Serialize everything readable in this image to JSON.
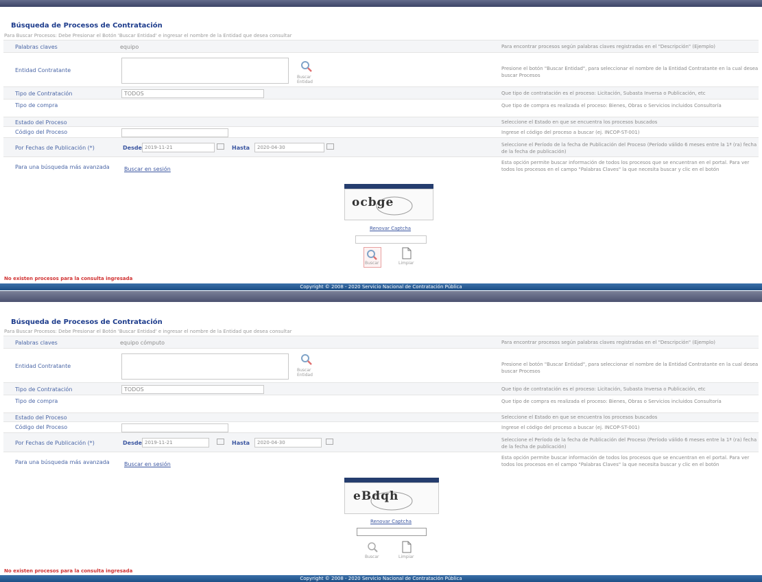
{
  "title": "Búsqueda de Procesos de Contratación",
  "subtitle": "Para Buscar Procesos: Debe Presionar el Botón 'Buscar Entidad' e ingresar el nombre de la Entidad que desea consultar",
  "panels": [
    {
      "fields": {
        "palabras_clave": {
          "label": "Palabras claves",
          "value": "equipo",
          "hint": "Para encontrar procesos según palabras claves registradas en el \"Descripción\" (Ejemplo)"
        },
        "entidad": {
          "label": "Entidad Contratante",
          "hint": "Presione el botón \"Buscar Entidad\", para seleccionar el nombre de la Entidad Contratante en la cual desea buscar Procesos",
          "button": "Buscar Entidad"
        },
        "tipo_contratacion": {
          "label": "Tipo de Contratación",
          "value": "TODOS",
          "hint": "Que tipo de contratación es el proceso: Licitación, Subasta Inversa o Publicación, etc"
        },
        "tipo_compra": {
          "label": "Tipo de compra",
          "hint": "Que tipo de compra es realizada el proceso: Bienes, Obras o Servicios incluidos Consultoría"
        },
        "estado": {
          "label": "Estado del Proceso",
          "hint": "Seleccione el Estado en que se encuentra los procesos buscados"
        },
        "codigo": {
          "label": "Código del Proceso",
          "hint": "Ingrese el código del proceso a buscar (ej. INCOP-ST-001)"
        },
        "fechas": {
          "label": "Por Fechas de Publicación (*)",
          "desde_label": "Desde",
          "desde": "2019-11-21",
          "hasta_label": "Hasta",
          "hasta": "2020-04-30",
          "hint": "Seleccione el Período de la fecha de Publicación del Proceso (Período válido 6 meses entre la 1ª (ra) fecha de la fecha de publicación)"
        },
        "avanzada": {
          "label": "Para una búsqueda más avanzada",
          "link": "Buscar en sesión",
          "hint": "Esta opción permite buscar información de todos los procesos que se encuentran en el portal. Para ver todos los procesos en el campo \"Palabras Claves\" la que necesita buscar y clic en el botón"
        }
      },
      "captcha": {
        "text": "ocbge",
        "refresh": "Renovar Captcha",
        "search": "Buscar",
        "clear": "Limpiar"
      },
      "error": "No existen procesos para la consulta ingresada",
      "footer": "Copyright © 2008 - 2020 Servicio Nacional de Contratación Pública"
    },
    {
      "fields": {
        "palabras_clave": {
          "label": "Palabras claves",
          "value": "equipo cómputo",
          "hint": "Para encontrar procesos según palabras claves registradas en el \"Descripción\" (Ejemplo)"
        },
        "entidad": {
          "label": "Entidad Contratante",
          "hint": "Presione el botón \"Buscar Entidad\", para seleccionar el nombre de la Entidad Contratante en la cual desea buscar Procesos",
          "button": "Buscar Entidad"
        },
        "tipo_contratacion": {
          "label": "Tipo de Contratación",
          "value": "TODOS",
          "hint": "Que tipo de contratación es el proceso: Licitación, Subasta Inversa o Publicación, etc"
        },
        "tipo_compra": {
          "label": "Tipo de compra",
          "hint": "Que tipo de compra es realizada el proceso: Bienes, Obras o Servicios incluidos Consultoría"
        },
        "estado": {
          "label": "Estado del Proceso",
          "hint": "Seleccione el Estado en que se encuentra los procesos buscados"
        },
        "codigo": {
          "label": "Código del Proceso",
          "hint": "Ingrese el código del proceso a buscar (ej. INCOP-ST-001)"
        },
        "fechas": {
          "label": "Por Fechas de Publicación (*)",
          "desde_label": "Desde",
          "desde": "2019-11-21",
          "hasta_label": "Hasta",
          "hasta": "2020-04-30",
          "hint": "Seleccione el Período de la fecha de Publicación del Proceso (Período válido 6 meses entre la 1ª (ra) fecha de la fecha de publicación)"
        },
        "avanzada": {
          "label": "Para una búsqueda más avanzada",
          "link": "Buscar en sesión",
          "hint": "Esta opción permite buscar información de todos los procesos que se encuentran en el portal. Para ver todos los procesos en el campo \"Palabras Claves\" la que necesita buscar y clic en el botón"
        }
      },
      "captcha": {
        "text": "eBdqh",
        "refresh": "Renovar Captcha",
        "search": "Buscar",
        "clear": "Limpiar"
      },
      "error": "No existen procesos para la consulta ingresada",
      "footer": "Copyright © 2008 - 2020 Servicio Nacional de Contratación Pública"
    }
  ]
}
